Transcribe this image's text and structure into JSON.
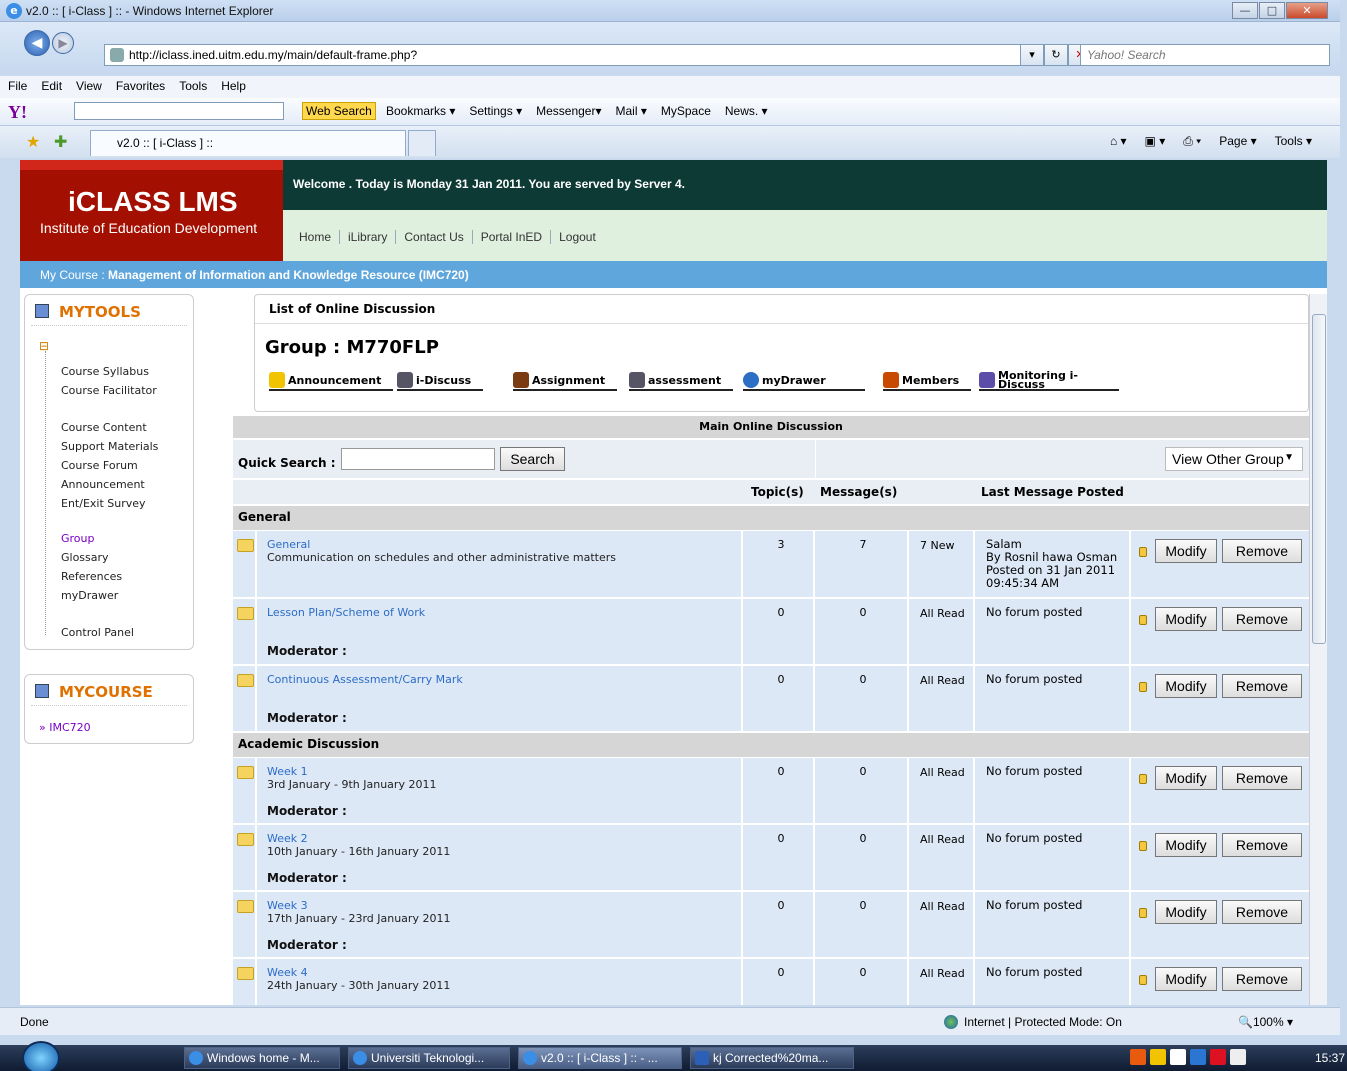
{
  "window": {
    "title": "v2.0 :: [ i-Class ] :: - Windows Internet Explorer"
  },
  "browser": {
    "url": "http://iclass.ined.uitm.edu.my/main/default-frame.php?",
    "search_placeholder": "Yahoo! Search",
    "menu": [
      "File",
      "Edit",
      "View",
      "Favorites",
      "Tools",
      "Help"
    ],
    "yahoo_toolbar": {
      "web_search": "Web Search",
      "items": [
        "Bookmarks ▾",
        "Settings ▾",
        "Messenger▾",
        "Mail ▾",
        "MySpace",
        "News. ▾"
      ]
    },
    "tab_title": "v2.0 :: [ i-Class ] ::",
    "command_bar": [
      "Page ▾",
      "Tools ▾"
    ]
  },
  "header": {
    "logo_title": "iCLASS LMS",
    "logo_subtitle": "Institute of Education Development",
    "welcome": "Welcome . Today is Monday 31 Jan 2011. You are served by Server 4.",
    "nav": [
      "Home",
      "iLibrary",
      "Contact Us",
      "Portal InED",
      "Logout"
    ],
    "course_prefix": "My Course : ",
    "course_name": "Management of Information and Knowledge Resource (IMC720)"
  },
  "sidebar": {
    "mytools_title": "MYTOOLS",
    "mytools_items": [
      "Course Syllabus",
      "Course Facilitator",
      "Course Content",
      "Support Materials",
      "Course Forum",
      "Announcement",
      "Ent/Exit Survey",
      "Group",
      "Glossary",
      "References",
      "myDrawer",
      "Control Panel"
    ],
    "mycourse_title": "MYCOURSE",
    "mycourse_items": [
      "» IMC720"
    ]
  },
  "main": {
    "list_header": "List of Online Discussion",
    "group_title": "Group : M770FLP",
    "tools": [
      "Announcement",
      "i-Discuss",
      "Assignment",
      "assessment",
      "myDrawer",
      "Members",
      "Monitoring i-Discuss"
    ],
    "table_title": "Main Online Discussion",
    "quick_search_label": "Quick Search :",
    "search_button": "Search",
    "view_other_group": "View Other Group",
    "columns": {
      "topics": "Topic(s)",
      "messages": "Message(s)",
      "last": "Last Message Posted"
    },
    "moderator_label": "Moderator :",
    "modify_label": "Modify",
    "remove_label": "Remove",
    "sections": [
      {
        "name": "General"
      },
      {
        "name": "Academic Discussion"
      }
    ],
    "forums": [
      {
        "title": "General",
        "desc": "Communication on schedules and other administrative matters",
        "topics": "3",
        "messages": "7",
        "status": "7 New",
        "last": [
          "Salam",
          "By Rosnil hawa Osman",
          "Posted on 31 Jan 2011",
          "09:45:34 AM"
        ]
      },
      {
        "title": "Lesson Plan/Scheme of Work",
        "desc": "",
        "topics": "0",
        "messages": "0",
        "status": "All Read",
        "last": [
          "No forum posted"
        ]
      },
      {
        "title": "Continuous Assessment/Carry Mark",
        "desc": "",
        "topics": "0",
        "messages": "0",
        "status": "All Read",
        "last": [
          "No forum posted"
        ]
      },
      {
        "title": "Week 1",
        "desc": "3rd January - 9th January 2011",
        "topics": "0",
        "messages": "0",
        "status": "All Read",
        "last": [
          "No forum posted"
        ]
      },
      {
        "title": "Week 2",
        "desc": "10th January - 16th January 2011",
        "topics": "0",
        "messages": "0",
        "status": "All Read",
        "last": [
          "No forum posted"
        ]
      },
      {
        "title": "Week 3",
        "desc": "17th January - 23rd January 2011",
        "topics": "0",
        "messages": "0",
        "status": "All Read",
        "last": [
          "No forum posted"
        ]
      },
      {
        "title": "Week 4",
        "desc": "24th January - 30th January 2011",
        "topics": "0",
        "messages": "0",
        "status": "All Read",
        "last": [
          "No forum posted"
        ]
      }
    ]
  },
  "statusbar": {
    "left": "Done",
    "zone": "Internet | Protected Mode: On",
    "zoom": "100%"
  },
  "taskbar": {
    "buttons": [
      "Windows home - M...",
      "Universiti Teknologi...",
      "v2.0 :: [ i-Class ] :: - ...",
      "kj Corrected%20ma..."
    ],
    "clock": "15:37"
  }
}
